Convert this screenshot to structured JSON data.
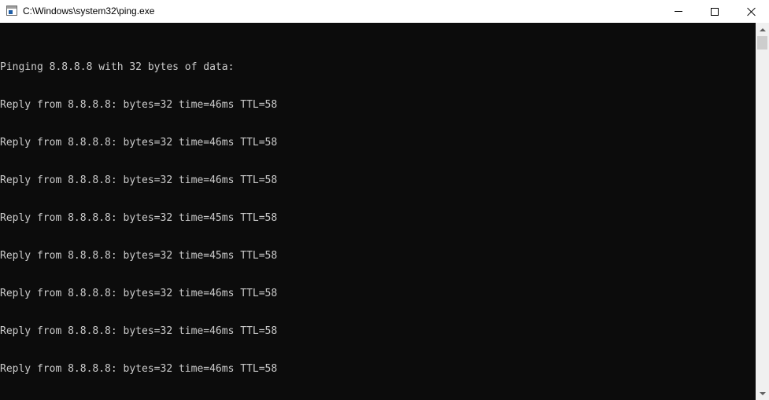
{
  "window": {
    "title": "C:\\Windows\\system32\\ping.exe",
    "app_icon": "console-window-icon",
    "buttons": {
      "minimize_icon": "minimize-icon",
      "maximize_icon": "maximize-icon",
      "close_icon": "close-icon"
    }
  },
  "console": {
    "background": "#0c0c0c",
    "foreground": "#cccccc",
    "lines": [
      "Pinging 8.8.8.8 with 32 bytes of data:",
      "Reply from 8.8.8.8: bytes=32 time=46ms TTL=58",
      "Reply from 8.8.8.8: bytes=32 time=46ms TTL=58",
      "Reply from 8.8.8.8: bytes=32 time=46ms TTL=58",
      "Reply from 8.8.8.8: bytes=32 time=45ms TTL=58",
      "Reply from 8.8.8.8: bytes=32 time=45ms TTL=58",
      "Reply from 8.8.8.8: bytes=32 time=46ms TTL=58",
      "Reply from 8.8.8.8: bytes=32 time=46ms TTL=58",
      "Reply from 8.8.8.8: bytes=32 time=46ms TTL=58"
    ]
  },
  "scrollbar": {
    "up_icon": "scroll-up-arrow-icon",
    "down_icon": "scroll-down-arrow-icon"
  }
}
